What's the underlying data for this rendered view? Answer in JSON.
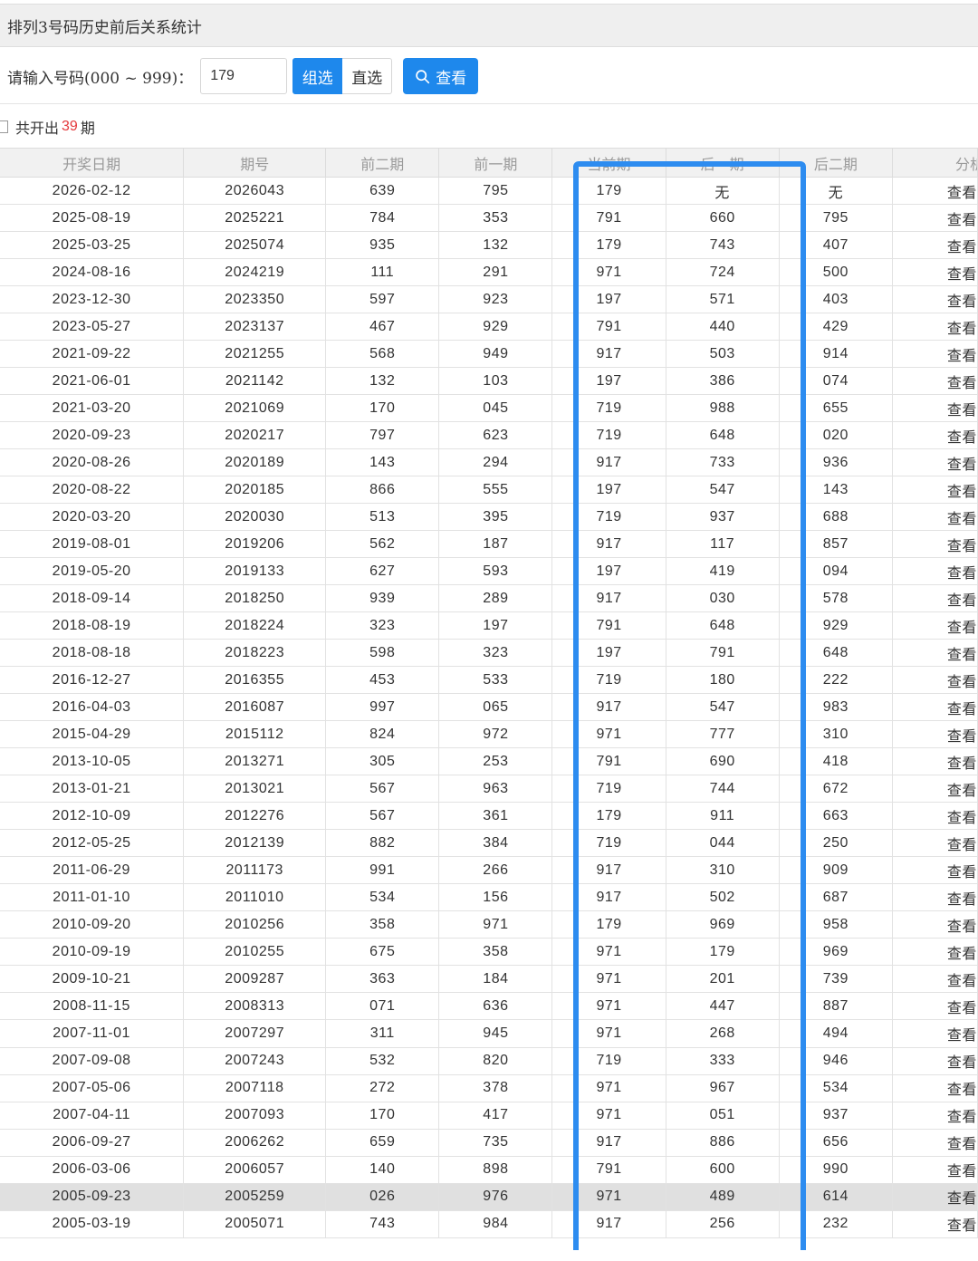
{
  "title": "排列3号码历史前后关系统计",
  "search": {
    "label": "请输入号码(000 ~ 999)：",
    "value": "179",
    "mode_group": "组选",
    "mode_direct": "直选",
    "view_button": "查看"
  },
  "summary": {
    "prefix": "共开出",
    "count": "39",
    "suffix": "期"
  },
  "columns": [
    "开奖日期",
    "期号",
    "前二期",
    "前一期",
    "当前期",
    "后一期",
    "后二期",
    "分析"
  ],
  "rows": [
    [
      "2026-02-12",
      "2026043",
      "639",
      "795",
      "179",
      "无",
      "无",
      "查看"
    ],
    [
      "2025-08-19",
      "2025221",
      "784",
      "353",
      "791",
      "660",
      "795",
      "查看"
    ],
    [
      "2025-03-25",
      "2025074",
      "935",
      "132",
      "179",
      "743",
      "407",
      "查看"
    ],
    [
      "2024-08-16",
      "2024219",
      "111",
      "291",
      "971",
      "724",
      "500",
      "查看"
    ],
    [
      "2023-12-30",
      "2023350",
      "597",
      "923",
      "197",
      "571",
      "403",
      "查看"
    ],
    [
      "2023-05-27",
      "2023137",
      "467",
      "929",
      "791",
      "440",
      "429",
      "查看"
    ],
    [
      "2021-09-22",
      "2021255",
      "568",
      "949",
      "917",
      "503",
      "914",
      "查看"
    ],
    [
      "2021-06-01",
      "2021142",
      "132",
      "103",
      "197",
      "386",
      "074",
      "查看"
    ],
    [
      "2021-03-20",
      "2021069",
      "170",
      "045",
      "719",
      "988",
      "655",
      "查看"
    ],
    [
      "2020-09-23",
      "2020217",
      "797",
      "623",
      "719",
      "648",
      "020",
      "查看"
    ],
    [
      "2020-08-26",
      "2020189",
      "143",
      "294",
      "917",
      "733",
      "936",
      "查看"
    ],
    [
      "2020-08-22",
      "2020185",
      "866",
      "555",
      "197",
      "547",
      "143",
      "查看"
    ],
    [
      "2020-03-20",
      "2020030",
      "513",
      "395",
      "719",
      "937",
      "688",
      "查看"
    ],
    [
      "2019-08-01",
      "2019206",
      "562",
      "187",
      "917",
      "117",
      "857",
      "查看"
    ],
    [
      "2019-05-20",
      "2019133",
      "627",
      "593",
      "197",
      "419",
      "094",
      "查看"
    ],
    [
      "2018-09-14",
      "2018250",
      "939",
      "289",
      "917",
      "030",
      "578",
      "查看"
    ],
    [
      "2018-08-19",
      "2018224",
      "323",
      "197",
      "791",
      "648",
      "929",
      "查看"
    ],
    [
      "2018-08-18",
      "2018223",
      "598",
      "323",
      "197",
      "791",
      "648",
      "查看"
    ],
    [
      "2016-12-27",
      "2016355",
      "453",
      "533",
      "719",
      "180",
      "222",
      "查看"
    ],
    [
      "2016-04-03",
      "2016087",
      "997",
      "065",
      "917",
      "547",
      "983",
      "查看"
    ],
    [
      "2015-04-29",
      "2015112",
      "824",
      "972",
      "971",
      "777",
      "310",
      "查看"
    ],
    [
      "2013-10-05",
      "2013271",
      "305",
      "253",
      "791",
      "690",
      "418",
      "查看"
    ],
    [
      "2013-01-21",
      "2013021",
      "567",
      "963",
      "719",
      "744",
      "672",
      "查看"
    ],
    [
      "2012-10-09",
      "2012276",
      "567",
      "361",
      "179",
      "911",
      "663",
      "查看"
    ],
    [
      "2012-05-25",
      "2012139",
      "882",
      "384",
      "719",
      "044",
      "250",
      "查看"
    ],
    [
      "2011-06-29",
      "2011173",
      "991",
      "266",
      "917",
      "310",
      "909",
      "查看"
    ],
    [
      "2011-01-10",
      "2011010",
      "534",
      "156",
      "917",
      "502",
      "687",
      "查看"
    ],
    [
      "2010-09-20",
      "2010256",
      "358",
      "971",
      "179",
      "969",
      "958",
      "查看"
    ],
    [
      "2010-09-19",
      "2010255",
      "675",
      "358",
      "971",
      "179",
      "969",
      "查看"
    ],
    [
      "2009-10-21",
      "2009287",
      "363",
      "184",
      "971",
      "201",
      "739",
      "查看"
    ],
    [
      "2008-11-15",
      "2008313",
      "071",
      "636",
      "971",
      "447",
      "887",
      "查看"
    ],
    [
      "2007-11-01",
      "2007297",
      "311",
      "945",
      "971",
      "268",
      "494",
      "查看"
    ],
    [
      "2007-09-08",
      "2007243",
      "532",
      "820",
      "719",
      "333",
      "946",
      "查看"
    ],
    [
      "2007-05-06",
      "2007118",
      "272",
      "378",
      "971",
      "967",
      "534",
      "查看"
    ],
    [
      "2007-04-11",
      "2007093",
      "170",
      "417",
      "971",
      "051",
      "937",
      "查看"
    ],
    [
      "2006-09-27",
      "2006262",
      "659",
      "735",
      "917",
      "886",
      "656",
      "查看"
    ],
    [
      "2006-03-06",
      "2006057",
      "140",
      "898",
      "791",
      "600",
      "990",
      "查看"
    ],
    [
      "2005-09-23",
      "2005259",
      "026",
      "976",
      "971",
      "489",
      "614",
      "查看"
    ],
    [
      "2005-03-19",
      "2005071",
      "743",
      "984",
      "917",
      "256",
      "232",
      "查看"
    ]
  ],
  "selected_row": 37,
  "colors": {
    "accent": "#1e88ec",
    "highlight_box": "#2d8cf0",
    "count_red": "#e4393c"
  }
}
